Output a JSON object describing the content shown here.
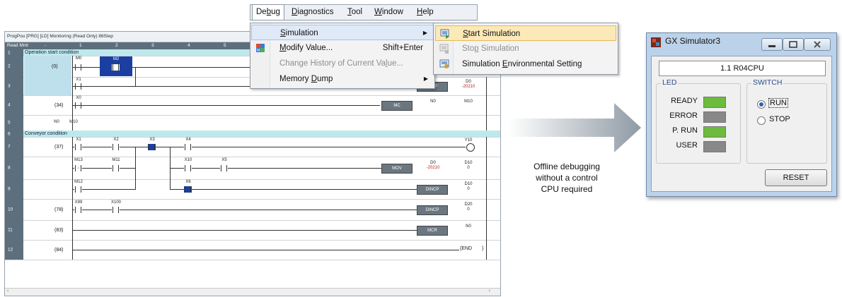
{
  "menu": {
    "items": [
      {
        "pre": "De",
        "u": "b",
        "post": "ug",
        "active": true
      },
      {
        "pre": "",
        "u": "D",
        "post": "iagnostics",
        "active": false
      },
      {
        "pre": "",
        "u": "T",
        "post": "ool",
        "active": false
      },
      {
        "pre": "",
        "u": "W",
        "post": "indow",
        "active": false
      },
      {
        "pre": "",
        "u": "H",
        "post": "elp",
        "active": false
      }
    ],
    "debug_items": [
      {
        "pre": "",
        "u": "S",
        "post": "imulation",
        "shortcut": "",
        "submenu": true,
        "disabled": false,
        "highlight": true
      },
      {
        "pre": "",
        "u": "M",
        "post": "odify Value...",
        "shortcut": "Shift+Enter",
        "submenu": false,
        "disabled": false,
        "highlight": false
      },
      {
        "pre": "Change History of Current Va",
        "u": "l",
        "post": "ue...",
        "shortcut": "",
        "submenu": false,
        "disabled": true,
        "highlight": false
      },
      {
        "pre": "Memory ",
        "u": "D",
        "post": "ump",
        "shortcut": "",
        "submenu": true,
        "disabled": false,
        "highlight": false
      }
    ],
    "simulation_items": [
      {
        "pre": "",
        "u": "S",
        "post": "tart Simulation",
        "disabled": false,
        "highlight": true
      },
      {
        "pre": "Sto",
        "u": "p",
        "post": " Simulation",
        "disabled": true,
        "highlight": false
      },
      {
        "pre": "Simulation ",
        "u": "E",
        "post": "nvironmental Setting",
        "disabled": false,
        "highlight": false
      }
    ]
  },
  "ladder": {
    "title": "ProgPou [PRG] [LD] Monitoring (Read Only) 86Step",
    "header": {
      "mode": "Read Mntr",
      "dash": "-",
      "columns": [
        "1",
        "2",
        "3",
        "4",
        "5"
      ]
    },
    "row_numbers": [
      "1",
      "2",
      "3",
      "4",
      "5",
      "6",
      "7",
      "8",
      "9",
      "10",
      "11",
      "12"
    ],
    "comments": [
      "Operation start condition",
      "Conveyor condition"
    ],
    "steps": [
      "(0)",
      "(34)",
      "(37)",
      "(78)",
      "(83)",
      "(84)"
    ],
    "devices": {
      "m0": "M0",
      "m2": "M2",
      "x1_a": "X1",
      "x0": "X0",
      "n0": "N0",
      "m10": "M10",
      "x1_b": "X1",
      "x2": "X2",
      "x3": "X3",
      "x4": "X4",
      "m13": "M13",
      "m11": "M11",
      "x10": "X10",
      "x5": "X5",
      "m12": "M12",
      "x6": "X6",
      "x99": "X99",
      "x100": "X100"
    },
    "instructions": {
      "incp": "INCP",
      "mc": "MC",
      "mov": "MOV",
      "dincp1": "DINCP",
      "dincp2": "DINCP",
      "mcr": "MCR"
    },
    "operands": {
      "incp_d": "D0",
      "incp_v": "-20210",
      "mc_n": "N0",
      "mc_m": "M10",
      "y10": "Y10",
      "mov_d": "D0",
      "mov_v": "-20210",
      "mov_t": "D10",
      "mov_tv": "0",
      "dincp1_d": "D10",
      "dincp1_v": "0",
      "dincp2_d": "D20",
      "dincp2_v": "0",
      "mcr_n": "N0",
      "end": "{END"
    },
    "scroll_left": "‹",
    "scroll_right": "›"
  },
  "caption": {
    "lines": [
      "Offline debugging",
      "without a control",
      "CPU required"
    ]
  },
  "simulator": {
    "title": "GX Simulator3",
    "cpu": "1.1  R04CPU",
    "led_title": "LED",
    "switch_title": "SWITCH",
    "leds": [
      {
        "label": "READY",
        "color": "#6dbb3c"
      },
      {
        "label": "ERROR",
        "color": "#888888"
      },
      {
        "label": "P. RUN",
        "color": "#6dbb3c"
      },
      {
        "label": "USER",
        "color": "#888888"
      }
    ],
    "switch": [
      {
        "label": "RUN",
        "checked": true
      },
      {
        "label": "STOP",
        "checked": false
      }
    ],
    "reset": "RESET"
  }
}
